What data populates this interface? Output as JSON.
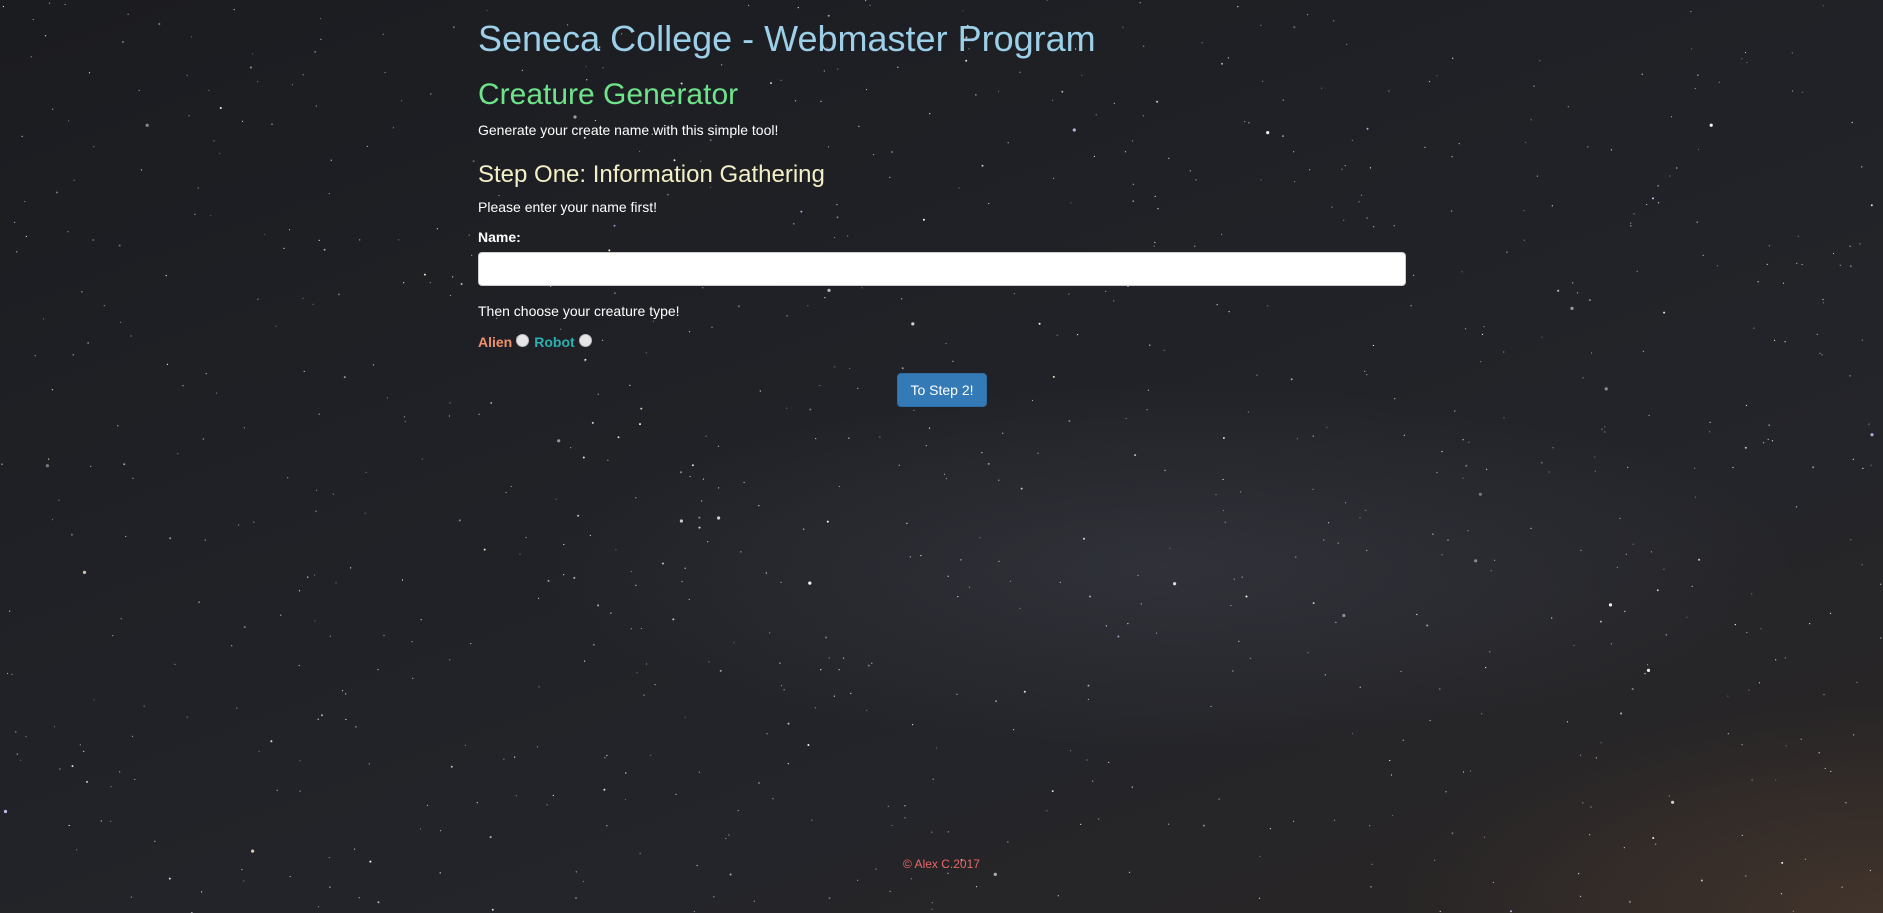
{
  "header": {
    "site_title": "Seneca College - Webmaster Program",
    "generator_title": "Creature Generator",
    "tagline": "Generate your create name with this simple tool!"
  },
  "step": {
    "title": "Step One: Information Gathering",
    "instructions": "Please enter your name first!",
    "name_label": "Name:",
    "name_value": "",
    "type_prompt": "Then choose your creature type!",
    "options": [
      {
        "label": "Alien",
        "selected": false
      },
      {
        "label": "Robot",
        "selected": false
      }
    ],
    "next_button": "To Step 2!"
  },
  "footer": {
    "copyright": "© Alex C.2017"
  },
  "colors": {
    "site_title": "#9ccfe8",
    "generator_title": "#6ee38a",
    "step_title": "#f3efc6",
    "alien": "#f0906a",
    "robot": "#2ab0b0",
    "button": "#337ab7",
    "footer": "#e86868"
  }
}
